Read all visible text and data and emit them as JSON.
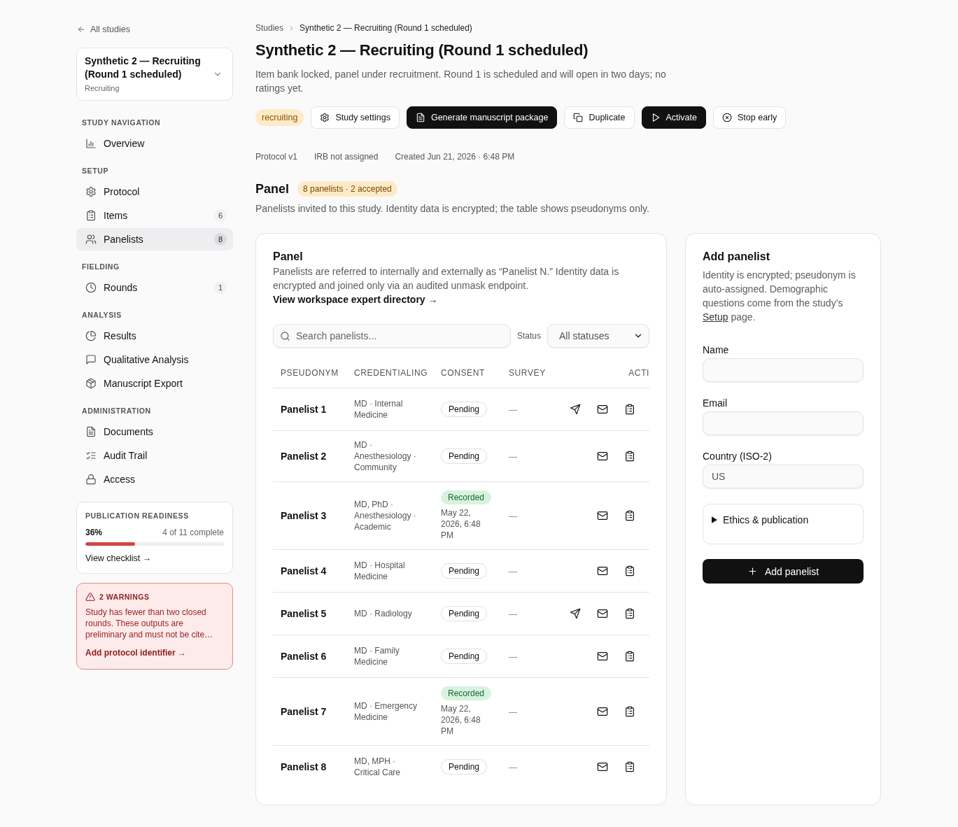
{
  "sidebar": {
    "back_link": "All studies",
    "study": {
      "title": "Synthetic 2 — Recruiting (Round 1 scheduled)",
      "status": "Recruiting"
    },
    "sections": [
      {
        "heading": "STUDY NAVIGATION",
        "items": [
          {
            "label": "Overview",
            "selected": false
          }
        ]
      },
      {
        "heading": "SETUP",
        "items": [
          {
            "label": "Protocol",
            "selected": false
          },
          {
            "label": "Items",
            "count": "6",
            "selected": false
          },
          {
            "label": "Panelists",
            "count": "8",
            "selected": true
          }
        ]
      },
      {
        "heading": "FIELDING",
        "items": [
          {
            "label": "Rounds",
            "count": "1",
            "selected": false
          }
        ]
      },
      {
        "heading": "ANALYSIS",
        "items": [
          {
            "label": "Results",
            "selected": false
          },
          {
            "label": "Qualitative Analysis",
            "selected": false
          },
          {
            "label": "Manuscript Export",
            "selected": false
          }
        ]
      },
      {
        "heading": "ADMINISTRATION",
        "items": [
          {
            "label": "Documents",
            "selected": false
          },
          {
            "label": "Audit Trail",
            "selected": false
          },
          {
            "label": "Access",
            "selected": false
          }
        ]
      }
    ],
    "readiness": {
      "title": "PUBLICATION READINESS",
      "percent": "36%",
      "summary": "4 of 11 complete",
      "level": 0.36,
      "link": "View checklist →"
    },
    "warnings": {
      "title": "2 WARNINGS",
      "message": "Study has fewer than two closed rounds. These outputs are preliminary and must not be cite…",
      "link": "Add protocol identifier →"
    }
  },
  "header": {
    "breadcrumb": [
      "Studies",
      "Synthetic 2 — Recruiting (Round 1 scheduled)"
    ],
    "title": "Synthetic 2 — Recruiting (Round 1 scheduled)",
    "description": "Item bank locked, panel under recruitment. Round 1 is scheduled and will open in two days; no ratings yet.",
    "status": "recruiting",
    "actions": [
      {
        "label": "Study settings",
        "kind": "secondary"
      },
      {
        "label": "Generate manuscript package",
        "kind": "primary"
      },
      {
        "label": "Duplicate",
        "kind": "secondary"
      },
      {
        "label": "Activate",
        "kind": "primary"
      },
      {
        "label": "Stop early",
        "kind": "secondary"
      }
    ],
    "meta": [
      "Protocol v1",
      "IRB not assigned",
      "Created Jun 21, 2026 · 6:48 PM"
    ]
  },
  "panel_section": {
    "title": "Panel",
    "badge": "8 panelists · 2 accepted",
    "description": "Panelists invited to this study. Identity data is encrypted; the table shows pseudonyms only."
  },
  "panel_card": {
    "title": "Panel",
    "description": "Panelists are referred to internally and externally as “Panelist N.” Identity data is encrypted and joined only via an audited unmask endpoint.",
    "link": "View workspace expert directory →",
    "search": {
      "placeholder": "Search panelists..."
    },
    "status_filter": {
      "label": "Status",
      "value": "All statuses"
    },
    "table": {
      "columns": [
        "PSEUDONYM",
        "CREDENTIALING",
        "CONSENT",
        "SURVEY",
        "ACTI"
      ],
      "rows": [
        {
          "pseudonym": "Panelist 1",
          "credentialing": "MD · Internal Medicine",
          "consent": {
            "kind": "pending",
            "label": "Pending"
          },
          "survey": "—",
          "can_send": true
        },
        {
          "pseudonym": "Panelist 2",
          "credentialing": "MD · Anesthesiology · Community",
          "consent": {
            "kind": "pending",
            "label": "Pending"
          },
          "survey": "—",
          "can_send": false
        },
        {
          "pseudonym": "Panelist 3",
          "credentialing": "MD, PhD · Anesthesiology · Academic",
          "consent": {
            "kind": "recorded",
            "label": "Recorded",
            "date": "May 22, 2026, 6:48 PM"
          },
          "survey": "—",
          "can_send": false
        },
        {
          "pseudonym": "Panelist 4",
          "credentialing": "MD · Hospital Medicine",
          "consent": {
            "kind": "pending",
            "label": "Pending"
          },
          "survey": "—",
          "can_send": false
        },
        {
          "pseudonym": "Panelist 5",
          "credentialing": "MD · Radiology",
          "consent": {
            "kind": "pending",
            "label": "Pending"
          },
          "survey": "—",
          "can_send": true
        },
        {
          "pseudonym": "Panelist 6",
          "credentialing": "MD · Family Medicine",
          "consent": {
            "kind": "pending",
            "label": "Pending"
          },
          "survey": "—",
          "can_send": false
        },
        {
          "pseudonym": "Panelist 7",
          "credentialing": "MD · Emergency Medicine",
          "consent": {
            "kind": "recorded",
            "label": "Recorded",
            "date": "May 22, 2026, 6:48 PM"
          },
          "survey": "—",
          "can_send": false
        },
        {
          "pseudonym": "Panelist 8",
          "credentialing": "MD, MPH · Critical Care",
          "consent": {
            "kind": "pending",
            "label": "Pending"
          },
          "survey": "—",
          "can_send": false
        }
      ]
    }
  },
  "add_panelist": {
    "title": "Add panelist",
    "description": "Identity is encrypted; pseudonym is auto-assigned. Demographic questions come from the study’s",
    "link": "Setup",
    "description_end": "page.",
    "fields": [
      {
        "label": "Name"
      },
      {
        "label": "Email"
      },
      {
        "label": "Country (ISO-2)",
        "value": "US"
      }
    ],
    "disclosure": {
      "label": "Ethics & publication",
      "expanded": false
    },
    "submit": "Add panelist"
  }
}
